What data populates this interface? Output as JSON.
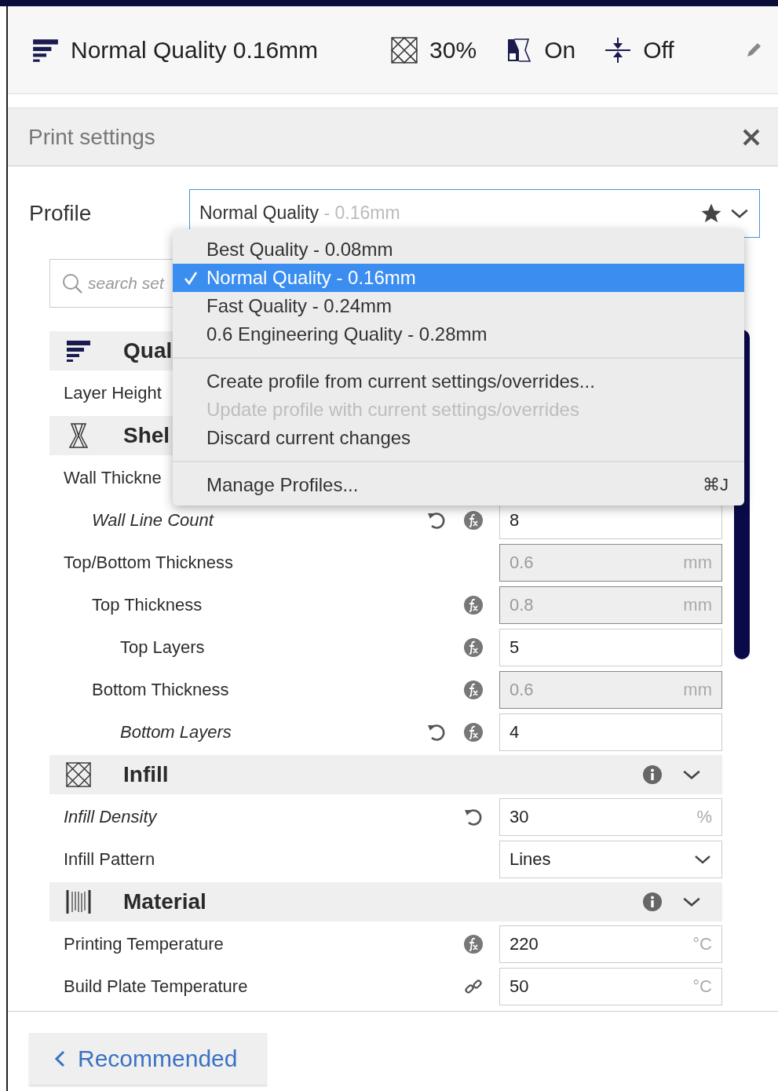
{
  "toolbar": {
    "profile": "Normal Quality 0.16mm",
    "infill": "30%",
    "support": "On",
    "adhesion": "Off"
  },
  "panel": {
    "title": "Print settings"
  },
  "profile": {
    "label": "Profile",
    "name": "Normal Quality",
    "detail": " - 0.16mm"
  },
  "search": {
    "placeholder": "search set"
  },
  "sections": [
    {
      "title": "Qual",
      "kind": "quality",
      "settings": [
        {
          "label": "Layer Height",
          "modified": false
        }
      ]
    },
    {
      "title": "Shel",
      "kind": "shell",
      "settings": [
        {
          "label": "Wall Thickne",
          "modified": false,
          "children": [
            {
              "label": "Wall Line Count",
              "modified": true,
              "reset": true,
              "formula": true,
              "linked": false,
              "field": {
                "kind": "text",
                "value": "8",
                "disabled": false
              }
            }
          ]
        },
        {
          "label": "Top/Bottom Thickness",
          "modified": false,
          "reset": false,
          "formula": false,
          "linked": false,
          "field": {
            "kind": "text",
            "value": "0.6",
            "unit": "mm",
            "disabled": true
          },
          "children": [
            {
              "label": "Top Thickness",
              "modified": false,
              "reset": false,
              "formula": true,
              "linked": false,
              "field": {
                "kind": "text",
                "value": "0.8",
                "unit": "mm",
                "disabled": true
              },
              "children": [
                {
                  "label": "Top Layers",
                  "modified": false,
                  "reset": false,
                  "formula": true,
                  "linked": false,
                  "field": {
                    "kind": "text",
                    "value": "5",
                    "disabled": false
                  }
                }
              ]
            },
            {
              "label": "Bottom Thickness",
              "modified": false,
              "reset": false,
              "formula": true,
              "linked": false,
              "field": {
                "kind": "text",
                "value": "0.6",
                "unit": "mm",
                "disabled": true
              },
              "children": [
                {
                  "label": "Bottom Layers",
                  "modified": true,
                  "reset": true,
                  "formula": true,
                  "linked": false,
                  "field": {
                    "kind": "text",
                    "value": "4",
                    "disabled": false
                  }
                }
              ]
            }
          ]
        }
      ]
    },
    {
      "title": "Infill",
      "kind": "infill",
      "info": true,
      "settings": [
        {
          "label": "Infill Density",
          "modified": true,
          "reset": true,
          "formula": false,
          "linked": false,
          "field": {
            "kind": "text",
            "value": "30",
            "unit": "%",
            "disabled": false
          }
        },
        {
          "label": "Infill Pattern",
          "modified": false,
          "reset": false,
          "formula": false,
          "linked": false,
          "field": {
            "kind": "dropdown",
            "value": "Lines",
            "disabled": false
          }
        }
      ]
    },
    {
      "title": "Material",
      "kind": "material",
      "info": true,
      "settings": [
        {
          "label": "Printing Temperature",
          "modified": false,
          "reset": false,
          "formula": true,
          "linked": false,
          "field": {
            "kind": "text",
            "value": "220",
            "unit": "°C",
            "disabled": false
          }
        },
        {
          "label": "Build Plate Temperature",
          "modified": false,
          "reset": false,
          "formula": false,
          "linked": true,
          "field": {
            "kind": "text",
            "value": "50",
            "unit": "°C",
            "disabled": false
          }
        }
      ]
    }
  ],
  "menu": {
    "items": [
      {
        "kind": "profile",
        "label": "Best Quality - 0.08mm",
        "selected": false
      },
      {
        "kind": "profile",
        "label": "Normal Quality - 0.16mm",
        "selected": true
      },
      {
        "kind": "profile",
        "label": "Fast Quality - 0.24mm",
        "selected": false
      },
      {
        "kind": "profile",
        "label": "0.6 Engineering Quality - 0.28mm",
        "selected": false
      },
      {
        "kind": "separator"
      },
      {
        "kind": "action",
        "label": "Create profile from current settings/overrides...",
        "disabled": false
      },
      {
        "kind": "action",
        "label": "Update profile with current settings/overrides",
        "disabled": true
      },
      {
        "kind": "action",
        "label": "Discard current changes",
        "disabled": false
      },
      {
        "kind": "separator"
      },
      {
        "kind": "action",
        "label": "Manage Profiles...",
        "disabled": false,
        "shortcut": "⌘J"
      }
    ]
  },
  "footer": {
    "button": "Recommended"
  }
}
